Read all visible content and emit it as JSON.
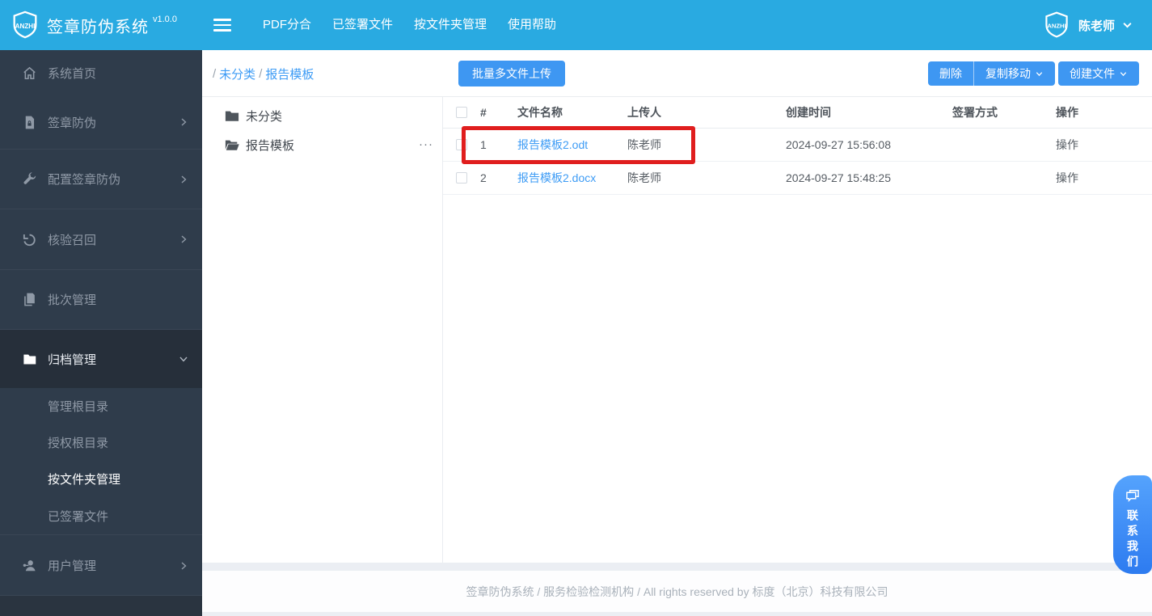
{
  "navbar": {
    "brand": "签章防伪系统",
    "version": "v1.0.0",
    "menu": [
      {
        "label": "PDF分合"
      },
      {
        "label": "已签署文件"
      },
      {
        "label": "按文件夹管理"
      },
      {
        "label": "使用帮助"
      }
    ],
    "user": {
      "name": "陈老师"
    }
  },
  "sidebar": {
    "items": [
      {
        "label": "系统首页",
        "icon": "home-icon"
      },
      {
        "label": "签章防伪",
        "icon": "file-lock-icon"
      },
      {
        "label": "配置签章防伪",
        "icon": "wrench-icon"
      },
      {
        "label": "核验召回",
        "icon": "undo-icon"
      },
      {
        "label": "批次管理",
        "icon": "copy-icon"
      },
      {
        "label": "归档管理",
        "icon": "folder-icon",
        "expanded": true,
        "children": [
          {
            "label": "管理根目录"
          },
          {
            "label": "授权根目录"
          },
          {
            "label": "按文件夹管理",
            "active": true
          },
          {
            "label": "已签署文件"
          }
        ]
      },
      {
        "label": "用户管理",
        "icon": "user-key-icon"
      }
    ]
  },
  "breadcrumb": {
    "sep": "/",
    "items": [
      "未分类",
      "报告模板"
    ]
  },
  "toolbar": {
    "upload_label": "批量多文件上传",
    "delete_label": "删除",
    "copy_move_label": "复制移动",
    "create_file_label": "创建文件"
  },
  "tree": {
    "folders": [
      {
        "name": "未分类",
        "state": "closed"
      },
      {
        "name": "报告模板",
        "state": "open",
        "more": "···"
      }
    ]
  },
  "table": {
    "headers": {
      "index": "#",
      "file": "文件名称",
      "uploader": "上传人",
      "created": "创建时间",
      "sign": "签署方式",
      "action": "操作"
    },
    "rows": [
      {
        "index": "1",
        "file": "报告模板2.odt",
        "uploader": "陈老师",
        "created": "2024-09-27 15:56:08",
        "sign": "",
        "action": "操作",
        "annotated": true
      },
      {
        "index": "2",
        "file": "报告模板2.docx",
        "uploader": "陈老师",
        "created": "2024-09-27 15:48:25",
        "sign": "",
        "action": "操作"
      }
    ]
  },
  "footer": {
    "text": "签章防伪系统 / 服务检验检测机构 / All rights reserved by 标度（北京）科技有限公司"
  },
  "contact": {
    "label": "联系我们"
  },
  "colors": {
    "navbar": "#29aae1",
    "sidebar": "#2f3c4b",
    "sidebar_active_bg": "#262f3a",
    "accent_blue": "#3e97f2",
    "link_blue": "#3e9cf5",
    "annotation_red": "#e01e1e"
  }
}
